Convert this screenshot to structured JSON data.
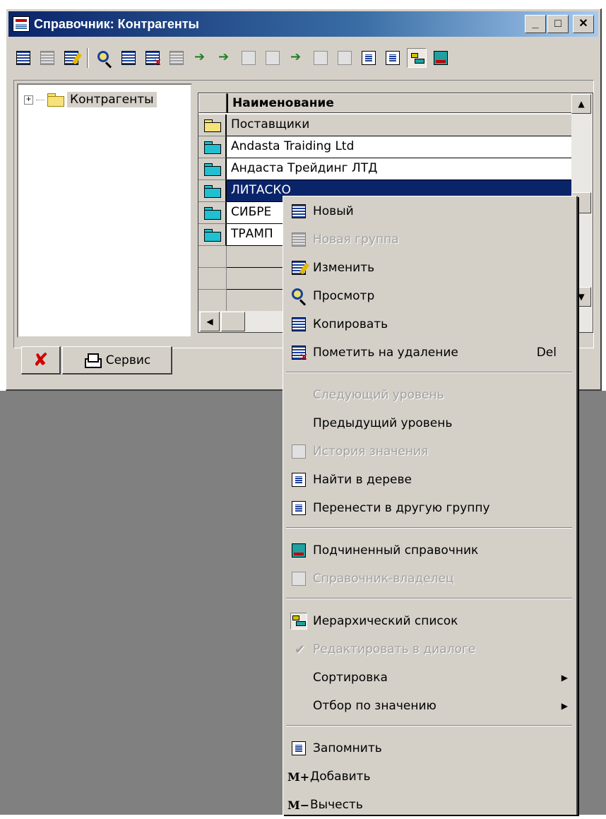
{
  "window": {
    "title": "Справочник: Контрагенты",
    "controls": {
      "minimize": "_",
      "maximize": "□",
      "close": "✕"
    }
  },
  "toolbar": {
    "icons": [
      "new-icon",
      "new-group-icon",
      "edit-icon",
      "view-icon",
      "copy-icon",
      "mark-delete-icon",
      "cut-icon",
      "move-to-group-icon",
      "next-level-icon",
      "prev-level-icon",
      "history-icon",
      "find-icon",
      "move-icon",
      "filter-icon",
      "value-history-icon",
      "find-in-tree-icon",
      "move-group-icon",
      "hierarchy-icon",
      "subordinate-icon"
    ]
  },
  "tree": {
    "expand": "+",
    "root_label": "Контрагенты"
  },
  "grid": {
    "column_header": "Наименование",
    "rows": [
      {
        "name": "Поставщики",
        "type": "group-open"
      },
      {
        "name": "Andasta Traiding Ltd",
        "type": "folder"
      },
      {
        "name": "Андаста Трейдинг ЛТД",
        "type": "folder"
      },
      {
        "name": "ЛИТАСКО",
        "type": "folder",
        "selected": true
      },
      {
        "name": "СИБРЕ",
        "type": "folder"
      },
      {
        "name": "ТРАМП",
        "type": "folder"
      }
    ]
  },
  "buttons": {
    "service_label": "Сервис"
  },
  "context_menu": {
    "items": [
      {
        "label": "Новый",
        "icon": "new-icon",
        "enabled": true
      },
      {
        "label": "Новая группа",
        "icon": "new-group-icon",
        "enabled": false
      },
      {
        "label": "Изменить",
        "icon": "edit-icon",
        "enabled": true
      },
      {
        "label": "Просмотр",
        "icon": "view-icon",
        "enabled": true
      },
      {
        "label": "Копировать",
        "icon": "copy-icon",
        "enabled": true
      },
      {
        "label": "Пометить на удаление",
        "icon": "mark-delete-icon",
        "enabled": true,
        "shortcut": "Del"
      },
      {
        "label": "Следующий уровень",
        "enabled": false
      },
      {
        "label": "Предыдущий уровень",
        "enabled": true
      },
      {
        "label": "История значения",
        "icon": "history-icon",
        "enabled": false
      },
      {
        "label": "Найти в дереве",
        "icon": "find-in-tree-icon",
        "enabled": true
      },
      {
        "label": "Перенести в другую группу",
        "icon": "move-group-icon",
        "enabled": true
      },
      {
        "label": "Подчиненный справочник",
        "icon": "subordinate-icon",
        "enabled": true
      },
      {
        "label": "Справочник-владелец",
        "icon": "owner-icon",
        "enabled": false
      },
      {
        "label": "Иерархический список",
        "icon": "hierarchy-icon",
        "enabled": true
      },
      {
        "label": "Редактировать в диалоге",
        "icon": "check-icon",
        "enabled": false
      },
      {
        "label": "Сортировка",
        "enabled": true,
        "submenu": "▶"
      },
      {
        "label": "Отбор по значению",
        "enabled": true,
        "submenu": "▶"
      },
      {
        "label": "Запомнить",
        "icon": "copy-memory-icon",
        "enabled": true
      },
      {
        "label": "Добавить",
        "prefix": "M+",
        "enabled": true
      },
      {
        "label": "Вычесть",
        "prefix": "M−",
        "enabled": true
      }
    ]
  },
  "colors": {
    "title_gradient_start": "#0a246a",
    "face": "#d4d0c8",
    "selection": "#0a246a",
    "disabled_text": "#a0a0a0",
    "desktop": "#808080"
  }
}
